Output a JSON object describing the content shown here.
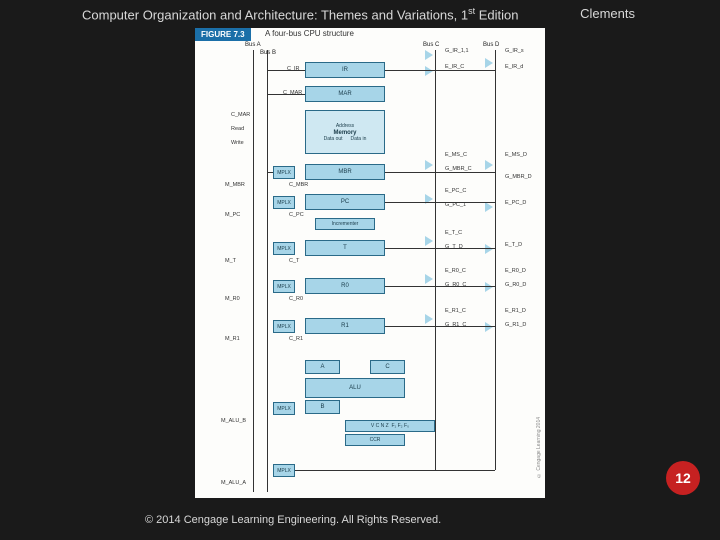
{
  "header": {
    "book_title_pre": "Computer Organization and Architecture: Themes and Variations, 1",
    "book_title_sup": "st",
    "book_title_post": " Edition",
    "author": "Clements"
  },
  "figure": {
    "label": "FIGURE 7.3",
    "caption": "A four-bus CPU structure",
    "side_copyright": "© Cengage Learning 2014"
  },
  "buses": {
    "a": "Bus A",
    "b": "Bus B",
    "c": "Bus C",
    "d": "Bus D"
  },
  "blocks": {
    "ir": "IR",
    "mar": "MAR",
    "address": "Address",
    "memory": "Memory",
    "dataout": "Data out",
    "datain": "Data in",
    "mbr": "MBR",
    "pc": "PC",
    "incrementer": "Incrementer",
    "t": "T",
    "r0": "R0",
    "r1": "R1",
    "alu_a": "A",
    "alu_c": "C",
    "alu": "ALU",
    "alu_b": "B",
    "ccr_flags": "V  C  N  Z",
    "ccr": "CCR",
    "ccr_f": "F₁  F₂  F₀"
  },
  "mplx": "MPLX",
  "signals": {
    "cir": "C_IR",
    "cmar": "C_MAR",
    "cread": "C_MAR",
    "read": "Read",
    "write": "Write",
    "cmbr": "C_MBR",
    "mmbr": "M_MBR",
    "mpc": "M_PC",
    "cpc": "C_PC",
    "ct": "C_T",
    "mt": "M_T",
    "cr0": "C_R0",
    "mr0": "M_R0",
    "cr1": "C_R1",
    "mr1": "M_R1",
    "malub": "M_ALU_B",
    "malua": "M_ALU_A",
    "girt1": "G_IR_1,1",
    "eirc": "E_IR_C",
    "girs": "G_IR_s",
    "eird": "E_IR_d",
    "emsc": "E_MS_C",
    "gmbrc": "G_MBR_C",
    "emsd": "E_MS_D",
    "gmbrd": "G_MBR_D",
    "epcc": "E_PC_C",
    "gpc1": "G_PC_1",
    "epcd": "E_PC_D",
    "gtd": "G_T_D",
    "etc": "E_T_C",
    "etd": "E_T_D",
    "er0c": "E_R0_C",
    "gr0c": "G_R0_C",
    "er0d": "E_R0_D",
    "gr0d": "G_R0_D",
    "er1c": "E_R1_C",
    "gr1c": "G_R1_C",
    "er1d": "E_R1_D",
    "gr1d": "G_R1_D"
  },
  "page_number": "12",
  "copyright": "© 2014 Cengage Learning Engineering. All Rights Reserved."
}
